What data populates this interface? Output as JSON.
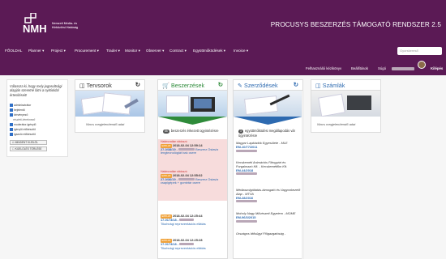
{
  "header": {
    "logo_text": "Nemzeti Média- és Hírközlési Hatóság",
    "system_title": "PROCUSYS BESZERZÉS TÁMOGATÓ RENDSZER 2.5",
    "search_placeholder": "Gyorskereső"
  },
  "nav": [
    {
      "label": "FŐOLDAL"
    },
    {
      "label": "Planner ▾"
    },
    {
      "label": "Project ▾"
    },
    {
      "label": "Procurement ▾"
    },
    {
      "label": "Trader ▾"
    },
    {
      "label": "Monitor ▾"
    },
    {
      "label": "Observer ▾"
    },
    {
      "label": "Contract ▾"
    },
    {
      "label": "Együttműködések ▾"
    },
    {
      "label": "Invoice ▾"
    }
  ],
  "subbar": {
    "manual": "Felhasználói kézikönyv",
    "settings": "Beállítások",
    "help": "Súgó",
    "logout": "Kilépés"
  },
  "sidebar": {
    "description": "Válassza ki, hogy mely jogosultsági alapján szeretné látni a nyitóoldal értesítéseit!",
    "filters": [
      {
        "label": "adminisztrátor",
        "sub": false
      },
      {
        "label": "bejelentő",
        "sub": false
      },
      {
        "label": "kérvényező",
        "sub": false
      },
      {
        "label": "részleti kérelmező",
        "sub": true
      },
      {
        "label": "moderátor-igénylő",
        "sub": false
      },
      {
        "label": "igénylő előkészítő",
        "sub": false
      },
      {
        "label": "igazoló előkészítő",
        "sub": false
      }
    ],
    "btn_all": "MINDENT KIJELÖL",
    "btn_clear": "KIJELÖLÉS TÖRLÉSE"
  },
  "cards": {
    "tervsorok": {
      "title": "Tervsorok",
      "empty": "Nincs megjelenítendő adat"
    },
    "beszerzesek": {
      "title": "Beszerzések",
      "badge": "86",
      "badge_text": "beszerzés érkezett ügyintézésre",
      "items": [
        {
          "status": "Határozatlan státuszú",
          "tag": "EPR-29",
          "date": "2018-02-04 12:59:14",
          "ref": "27-0/38/19 -",
          "name": "Beszerz Ostaviz lengtecnológiát bak csere"
        },
        {
          "status": "Határozatlan státuszú",
          "tag": "EPR-29",
          "date": "2018-02-04 12:55:02",
          "ref": "27-0/36/19 -",
          "name": "Beszerz Ostaviz csapigépek + gombtár csere"
        },
        {
          "status": "",
          "tag": "EPR-29",
          "date": "2018-02-04 12:25:44",
          "ref": "17-0173/18 -",
          "name": "Tikohnági reprezentációs ellátás"
        },
        {
          "status": "",
          "tag": "EPR-29",
          "date": "2018-02-04 12:25:28",
          "ref": "17-0173/18 -",
          "name": "Tikohnági reprezentációs ellátás"
        }
      ]
    },
    "szerzodesek": {
      "title": "Szerződések",
      "badge": "3",
      "badge_text": "együttműködési megállapodás vár ügyintézésre",
      "items": [
        {
          "name": "Magyar Lapkiadók Egyesülete - MLE",
          "code": "EM-10/77/2011"
        },
        {
          "name": "Kecskeméti Animációs Filmgyárt és Forgalmazó Kft. - Kecskemétfilm Kft.",
          "code": "EM-44/2018"
        },
        {
          "name": "Médiaszolgáltatás-támogató és Vagyonkezelő Alap - MTVA",
          "code": "EM-28/2016"
        },
        {
          "name": "Moholy-Nagy Művészeti Egyetem - MOME",
          "code": "EM-96/3/2015"
        },
        {
          "name": "Országos Idősügyi Főigazgatóság -",
          "code": ""
        }
      ]
    },
    "szamlak": {
      "title": "Számlák",
      "empty": "Nincs megjelenítendő adat"
    }
  },
  "colors": {
    "brand": "#5b1a55",
    "beszerzes_accent": "#2e8b3a",
    "szerzodes_accent": "#2d6ab0",
    "orange_tag": "#f0a23a"
  }
}
